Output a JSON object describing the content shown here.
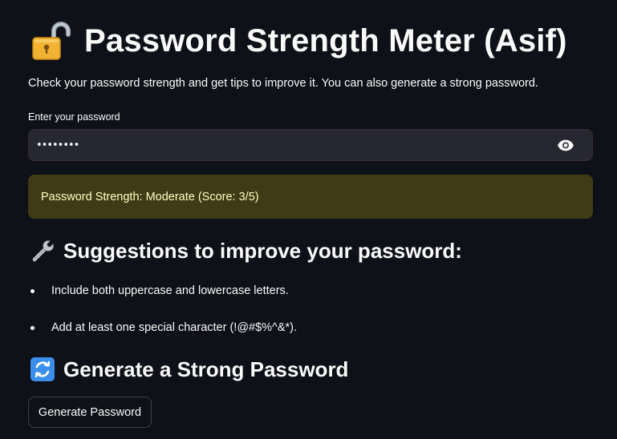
{
  "app": {
    "title": "Password Strength Meter (Asif)",
    "title_icon": "open-lock-icon",
    "intro": "Check your password strength and get tips to improve it. You can also generate a strong password."
  },
  "password_field": {
    "label": "Enter your password",
    "value": "••••••••",
    "toggle_icon": "eye-icon"
  },
  "strength": {
    "message": "Password Strength: Moderate (Score: 3/5)",
    "score": 3,
    "max_score": 5,
    "level": "Moderate",
    "background_color": "#3e3b16",
    "text_color": "#ffffc2"
  },
  "suggestions": {
    "heading": "Suggestions to improve your password:",
    "icon": "wrench-icon",
    "items": [
      "Include both uppercase and lowercase letters.",
      "Add at least one special character (!@#$%^&*)."
    ]
  },
  "generator": {
    "heading": "Generate a Strong Password",
    "icon": "refresh-arrows-icon",
    "button_label": "Generate Password"
  },
  "theme": {
    "background": "#0e1117",
    "input_background": "#262730",
    "text": "#fafafa"
  }
}
